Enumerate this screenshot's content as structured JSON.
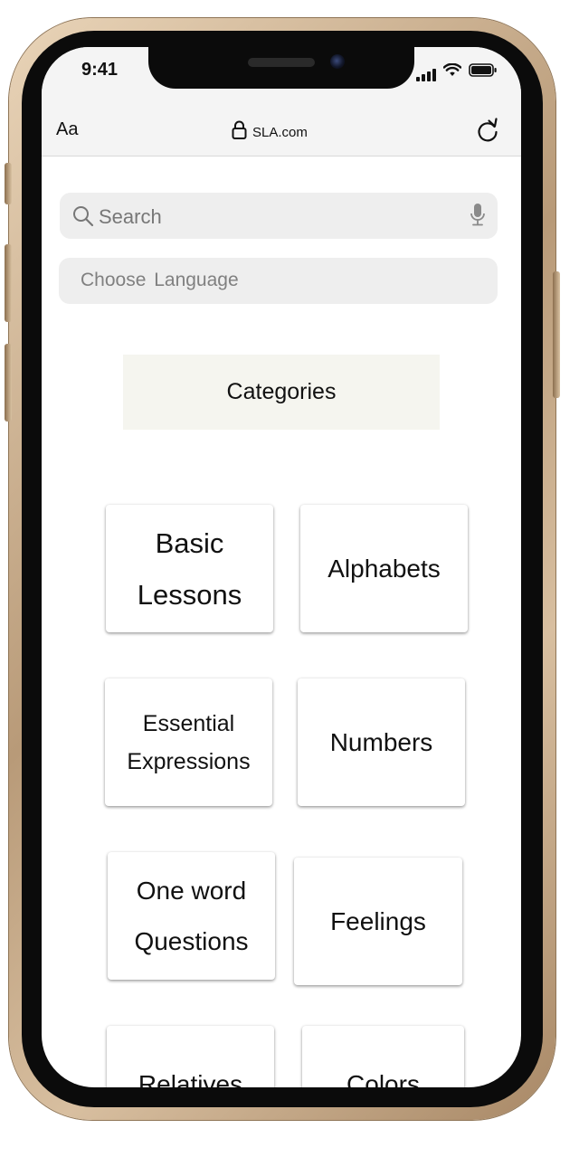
{
  "status_bar": {
    "time": "9:41",
    "icons": [
      "cellular-signal-icon",
      "wifi-icon",
      "battery-icon"
    ]
  },
  "browser": {
    "text_size_label": "Aa",
    "url": "SLA.com",
    "icons": [
      "lock-icon",
      "reload-icon"
    ]
  },
  "search": {
    "placeholder": "Search",
    "icons": [
      "search-icon",
      "microphone-icon"
    ]
  },
  "language_select": {
    "label": "Choose  Language"
  },
  "categories": {
    "title": "Categories",
    "items": [
      {
        "line1": "Basic",
        "line2": "Lessons"
      },
      {
        "line1": "Alphabets",
        "line2": ""
      },
      {
        "line1": "Essential",
        "line2": "Expressions"
      },
      {
        "line1": "Numbers",
        "line2": ""
      },
      {
        "line1": "One word",
        "line2": "Questions"
      },
      {
        "line1": "Feelings",
        "line2": ""
      },
      {
        "line1": "Relatives",
        "line2": ""
      },
      {
        "line1": "Colors",
        "line2": ""
      }
    ]
  },
  "colors": {
    "frame_gold": "#c9ad8b",
    "screen_bg": "#ffffff",
    "field_bg": "#eeeeee",
    "categories_bg": "#f5f5ef",
    "text": "#111111",
    "placeholder_text": "#777777"
  }
}
